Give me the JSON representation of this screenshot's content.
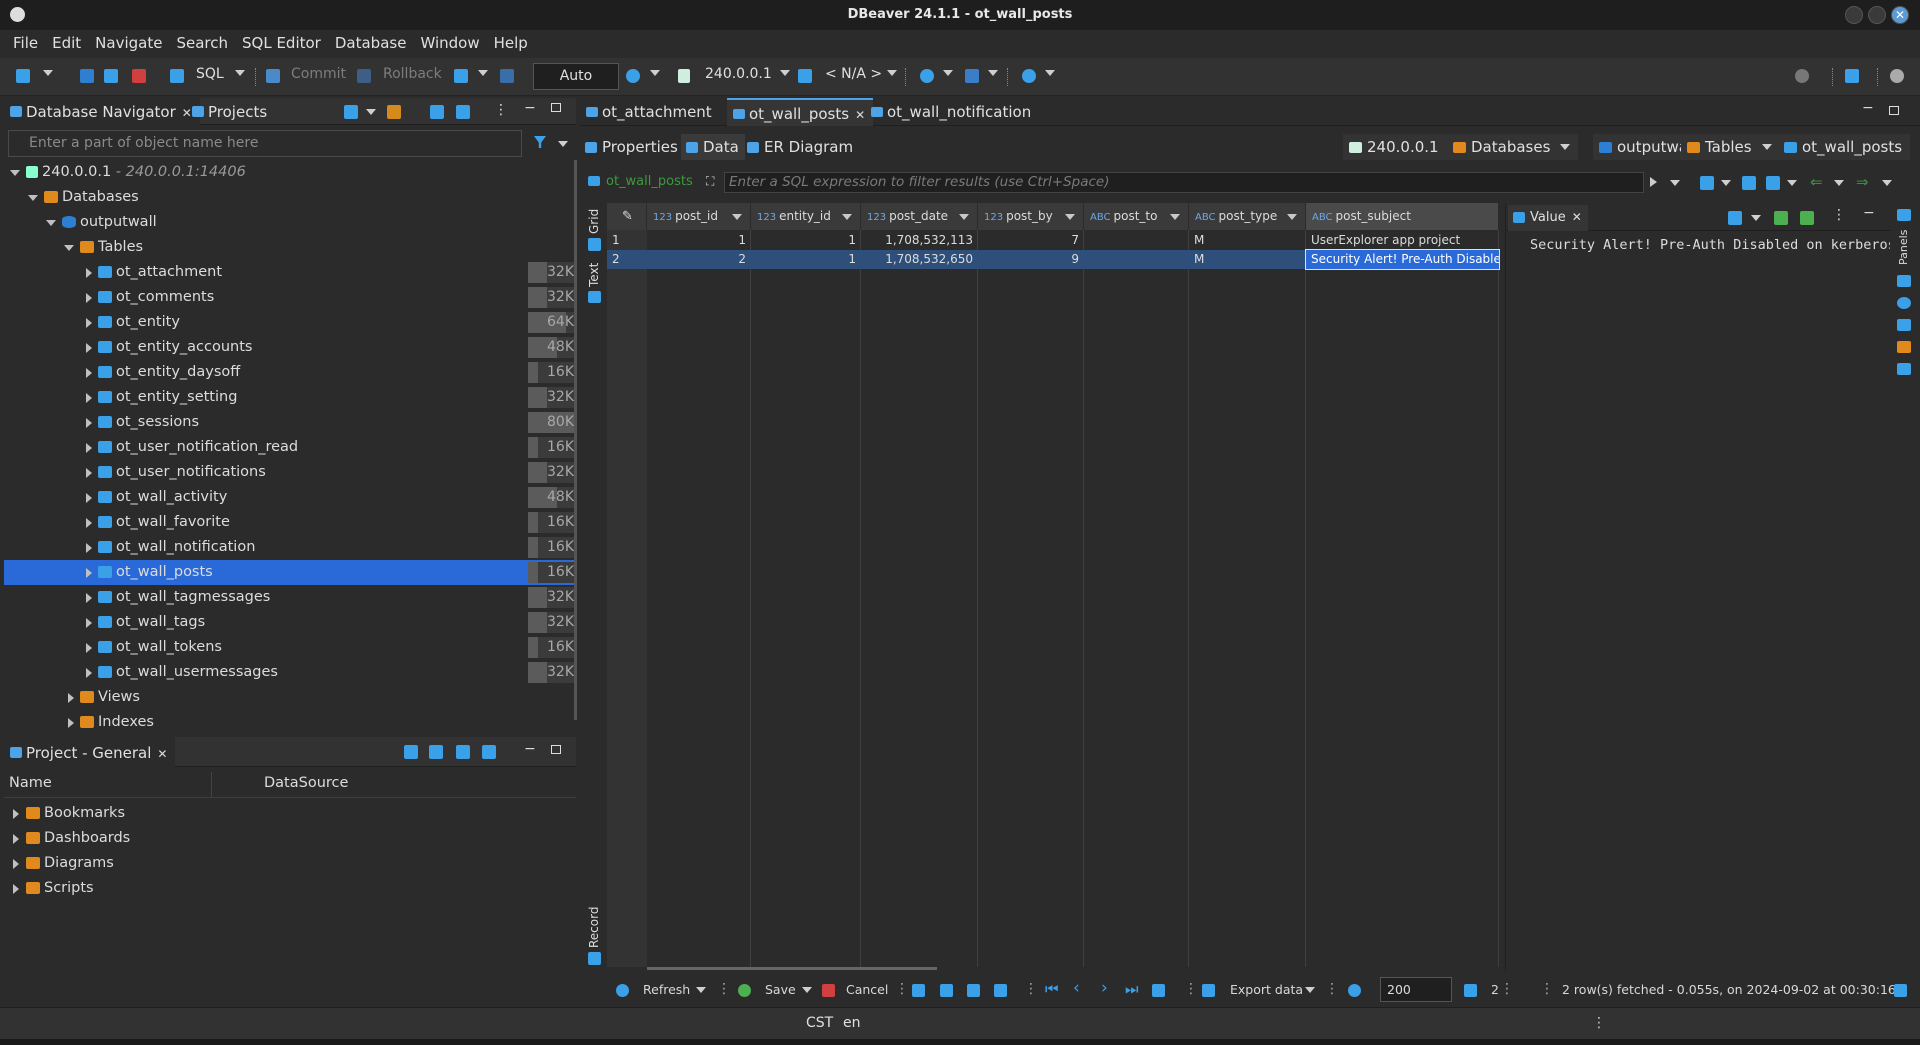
{
  "window": {
    "title": "DBeaver 24.1.1 - ot_wall_posts"
  },
  "menu": [
    "File",
    "Edit",
    "Navigate",
    "Search",
    "SQL Editor",
    "Database",
    "Window",
    "Help"
  ],
  "toolbar": {
    "sql_label": "SQL",
    "commit_label": "Commit",
    "rollback_label": "Rollback",
    "transaction_mode": "Auto",
    "connection": "240.0.0.1",
    "schema": "< N/A >"
  },
  "navigator": {
    "tab_label": "Database Navigator",
    "projects_tab_label": "Projects",
    "filter_placeholder": "Enter a part of object name here",
    "connection_label": "240.0.0.1",
    "connection_detail": " - 240.0.0.1:14406",
    "databases_label": "Databases",
    "database_label": "outputwall",
    "tables_label": "Tables",
    "tables": [
      {
        "name": "ot_attachment",
        "size": "32K",
        "fill": 0.4
      },
      {
        "name": "ot_comments",
        "size": "32K",
        "fill": 0.4
      },
      {
        "name": "ot_entity",
        "size": "64K",
        "fill": 0.8
      },
      {
        "name": "ot_entity_accounts",
        "size": "48K",
        "fill": 0.6
      },
      {
        "name": "ot_entity_daysoff",
        "size": "16K",
        "fill": 0.2
      },
      {
        "name": "ot_entity_setting",
        "size": "32K",
        "fill": 0.4
      },
      {
        "name": "ot_sessions",
        "size": "80K",
        "fill": 1.0
      },
      {
        "name": "ot_user_notification_read",
        "size": "16K",
        "fill": 0.2
      },
      {
        "name": "ot_user_notifications",
        "size": "32K",
        "fill": 0.4
      },
      {
        "name": "ot_wall_activity",
        "size": "48K",
        "fill": 0.6
      },
      {
        "name": "ot_wall_favorite",
        "size": "16K",
        "fill": 0.2
      },
      {
        "name": "ot_wall_notification",
        "size": "16K",
        "fill": 0.2
      },
      {
        "name": "ot_wall_posts",
        "size": "16K",
        "fill": 0.2
      },
      {
        "name": "ot_wall_tagmessages",
        "size": "32K",
        "fill": 0.4
      },
      {
        "name": "ot_wall_tags",
        "size": "32K",
        "fill": 0.4
      },
      {
        "name": "ot_wall_tokens",
        "size": "16K",
        "fill": 0.2
      },
      {
        "name": "ot_wall_usermessages",
        "size": "32K",
        "fill": 0.4
      }
    ],
    "views_label": "Views",
    "indexes_label": "Indexes"
  },
  "project": {
    "tab_label": "Project - General",
    "col_name": "Name",
    "col_datasource": "DataSource",
    "items": [
      "Bookmarks",
      "Dashboards",
      "Diagrams",
      "Scripts"
    ]
  },
  "editor": {
    "tabs": [
      "ot_attachment",
      "ot_wall_posts",
      "ot_wall_notification"
    ],
    "subtabs": [
      "Properties",
      "Data",
      "ER Diagram"
    ],
    "breadcrumbs": [
      "240.0.0.1",
      "Databases",
      "outputwall",
      "Tables",
      "ot_wall_posts"
    ],
    "filter_table": "ot_wall_posts",
    "filter_placeholder": "Enter a SQL expression to filter results (use Ctrl+Space)"
  },
  "grid": {
    "side_labels": {
      "grid": "Grid",
      "text": "Text",
      "record": "Record"
    },
    "columns": [
      {
        "type": "123",
        "name": "post_id"
      },
      {
        "type": "123",
        "name": "entity_id"
      },
      {
        "type": "123",
        "name": "post_date"
      },
      {
        "type": "123",
        "name": "post_by"
      },
      {
        "type": "ABC",
        "name": "post_to"
      },
      {
        "type": "ABC",
        "name": "post_type"
      },
      {
        "type": "ABC",
        "name": "post_subject"
      }
    ],
    "rows": [
      {
        "num": "1",
        "cells": [
          "1",
          "1",
          "1,708,532,113",
          "7",
          "",
          "M",
          "UserExplorer app  project"
        ]
      },
      {
        "num": "2",
        "cells": [
          "2",
          "1",
          "1,708,532,650",
          "9",
          "",
          "M",
          "Security Alert! Pre-Auth Disabled o"
        ]
      }
    ]
  },
  "value_panel": {
    "tab_label": "Value",
    "content": "Security Alert! Pre-Auth Disabled on kerberos",
    "side_label": "Panels"
  },
  "data_toolbar": {
    "refresh_label": "Refresh",
    "save_label": "Save",
    "cancel_label": "Cancel",
    "export_label": "Export data",
    "fetch_size": "200",
    "count": "2",
    "status": "2 row(s) fetched - 0.055s, on 2024-09-02 at 00:30:16"
  },
  "statusbar": {
    "timezone": "CST",
    "locale": "en"
  }
}
